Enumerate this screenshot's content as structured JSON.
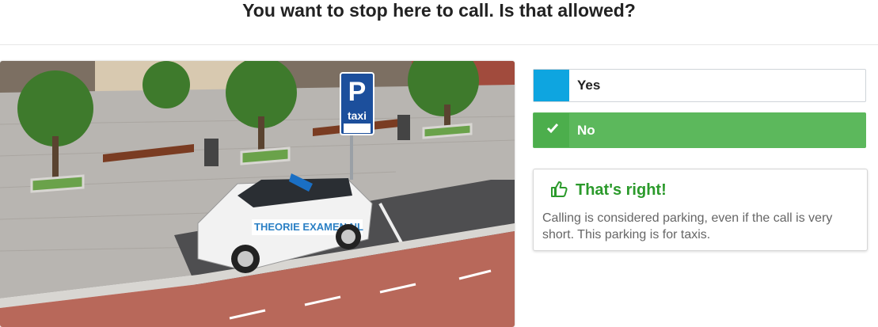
{
  "question": "You want to stop here to call. Is that allowed?",
  "scene": {
    "sign_letter": "P",
    "sign_text": "taxi",
    "car_brand": "THEORIE EXAMEN.NL"
  },
  "answers": [
    {
      "label": "Yes",
      "color": "#0ea5e0"
    },
    {
      "label": "No",
      "color": "#5cb85c",
      "selected": true
    }
  ],
  "feedback": {
    "title": "That's right!",
    "text": "Calling is considered parking, even if the call is very short. This parking is for taxis."
  }
}
